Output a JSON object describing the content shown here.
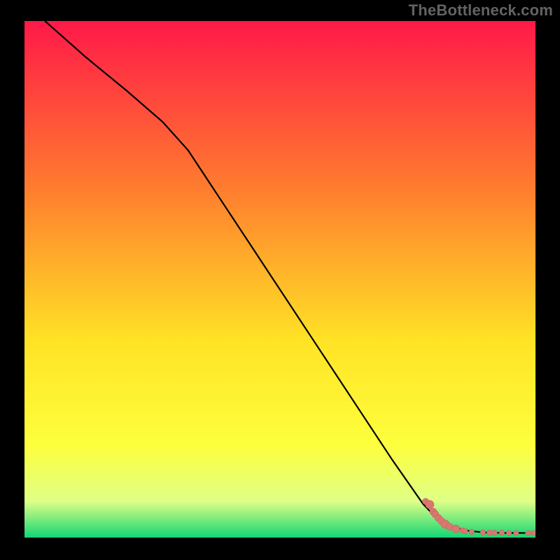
{
  "watermark": "TheBottleneck.com",
  "colors": {
    "page_bg": "#000000",
    "watermark": "#636363",
    "grad_top": "#ff1948",
    "grad_mid1": "#ff7b2f",
    "grad_mid2": "#ffe325",
    "grad_mid3": "#fdff3d",
    "grad_low": "#dfff86",
    "grad_bot": "#13d675",
    "line": "#000000",
    "marker_fill": "#d97871",
    "marker_stroke": "#c96058"
  },
  "chart_data": {
    "type": "line",
    "title": "",
    "xlabel": "",
    "ylabel": "",
    "xlim": [
      0,
      100
    ],
    "ylim": [
      0,
      100
    ],
    "series": [
      {
        "name": "curve",
        "x": [
          4,
          12,
          20,
          27,
          32,
          38,
          45,
          52,
          58,
          65,
          72,
          78,
          81,
          84,
          87,
          90,
          94,
          98
        ],
        "y": [
          100,
          93,
          86.5,
          80.5,
          75,
          66,
          55.5,
          45,
          36,
          25.5,
          15,
          6.5,
          3.4,
          2.0,
          1.3,
          1.0,
          0.9,
          0.9
        ]
      }
    ],
    "markers": [
      {
        "x": 78.5,
        "y": 7.0,
        "r": 4.5
      },
      {
        "x": 79.3,
        "y": 6.4,
        "r": 6
      },
      {
        "x": 80.0,
        "y": 5.0,
        "r": 5
      },
      {
        "x": 80.4,
        "y": 4.5,
        "r": 5
      },
      {
        "x": 81.0,
        "y": 3.8,
        "r": 5
      },
      {
        "x": 81.6,
        "y": 3.2,
        "r": 5
      },
      {
        "x": 82.3,
        "y": 2.6,
        "r": 6
      },
      {
        "x": 83.2,
        "y": 2.1,
        "r": 5
      },
      {
        "x": 84.4,
        "y": 1.7,
        "r": 5.5
      },
      {
        "x": 85.7,
        "y": 1.4,
        "r": 3.8
      },
      {
        "x": 86.2,
        "y": 1.25,
        "r": 3.8
      },
      {
        "x": 87.5,
        "y": 1.1,
        "r": 3.8
      },
      {
        "x": 89.7,
        "y": 1.0,
        "r": 3.8
      },
      {
        "x": 91.0,
        "y": 0.95,
        "r": 3.8
      },
      {
        "x": 92.0,
        "y": 0.95,
        "r": 3.8
      },
      {
        "x": 93.4,
        "y": 0.95,
        "r": 3.8
      },
      {
        "x": 94.8,
        "y": 0.9,
        "r": 3.6
      },
      {
        "x": 96.2,
        "y": 0.9,
        "r": 3.6
      },
      {
        "x": 98.6,
        "y": 0.9,
        "r": 3.6
      },
      {
        "x": 99.7,
        "y": 0.9,
        "r": 3.6
      }
    ]
  }
}
